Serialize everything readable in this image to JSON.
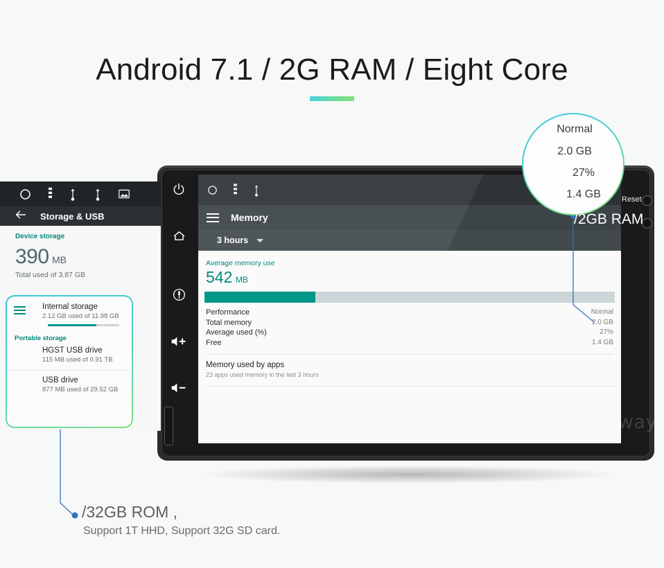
{
  "headline": "Android 7.1 / 2G RAM / Eight Core",
  "accent": {
    "teal": "#009688",
    "teal_text": "#00897b",
    "gradient_start": "#49d2e0",
    "gradient_end": "#86e07e",
    "callout_blue": "#2f74c0"
  },
  "magnifier": {
    "lines": [
      "Normal",
      "2.0 GB",
      "27%",
      "1.4 GB"
    ]
  },
  "callouts": {
    "ram": "/2GB RAM",
    "rom": "/32GB ROM ,",
    "rom_sub": "Support 1T HHD, Support 32G SD card."
  },
  "device": {
    "reset_label": "Reset",
    "watermark": "Uniway",
    "buttons": [
      {
        "name": "power-button",
        "icon": "power-icon"
      },
      {
        "name": "home-button",
        "icon": "home-icon"
      },
      {
        "name": "mic-button",
        "icon": "mic-icon"
      },
      {
        "name": "volume-up-button",
        "icon": "volume-up-icon"
      },
      {
        "name": "volume-down-button",
        "icon": "volume-down-icon"
      }
    ]
  },
  "memory_app": {
    "statusbar_icons": [
      "circle-icon",
      "more-vertical-icon",
      "usb-icon",
      "bluetooth-icon"
    ],
    "title": "Memory",
    "time_range": "3 hours",
    "avg_label": "Average memory use",
    "avg_value": "542",
    "avg_unit": "MB",
    "bar_percent": 27,
    "stats": [
      {
        "label": "Performance",
        "value": "Normal"
      },
      {
        "label": "Total memory",
        "value": "2.0 GB"
      },
      {
        "label": "Average used (%)",
        "value": "27%"
      },
      {
        "label": "Free",
        "value": "1.4 GB"
      }
    ],
    "apps_title": "Memory used by apps",
    "apps_sub": "23 apps used memory in the last 3 hours"
  },
  "storage_app": {
    "statusbar_icons": [
      "circle-icon",
      "more-vertical-icon",
      "usb-icon",
      "usb-icon",
      "image-icon"
    ],
    "title": "Storage & USB",
    "back_icon": "arrow-back-icon",
    "device_storage_label": "Device storage",
    "used_value": "390",
    "used_unit": "MB",
    "total_used": "Total used of 3.87 GB",
    "internal": {
      "name": "Internal storage",
      "detail": "2.12 GB used of 11.98 GB",
      "bar_percent": 68,
      "icon": "list-icon"
    },
    "portable_label": "Portable storage",
    "portable": [
      {
        "name": "HGST USB drive",
        "detail": "115 MB used of 0.91 TB",
        "icon": "sd-card-icon"
      },
      {
        "name": "USB drive",
        "detail": "877 MB used of 29.52 GB",
        "icon": "sd-card-icon"
      }
    ]
  }
}
